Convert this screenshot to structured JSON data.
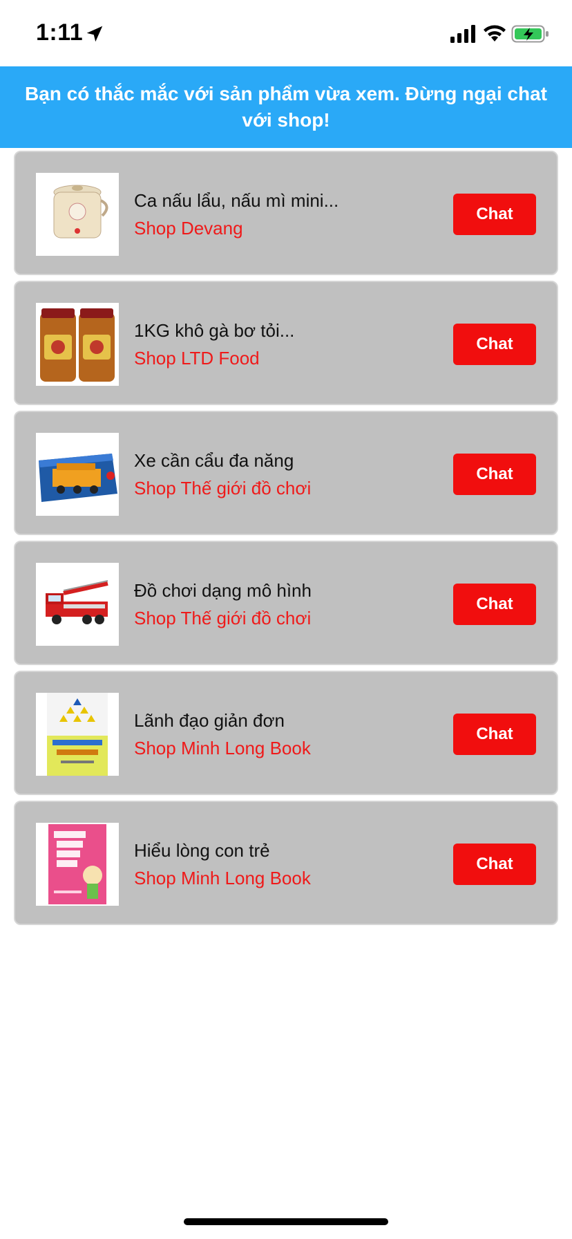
{
  "status_bar": {
    "time": "1:11",
    "icons": [
      "location-arrow-icon",
      "cellular-signal-icon",
      "wifi-icon",
      "battery-charging-icon"
    ]
  },
  "banner": {
    "text": "Bạn có thắc mắc với sản phẩm vừa xem. Đừng ngại chat với shop!",
    "background": "#2aa9f7"
  },
  "items": [
    {
      "name": "Ca nấu lẩu, nấu mì mini...",
      "shop": "Shop Devang",
      "chat_label": "Chat",
      "image": "electric-pot-image"
    },
    {
      "name": "1KG khô gà bơ tỏi...",
      "shop": "Shop LTD Food",
      "chat_label": "Chat",
      "image": "dried-chicken-jars-image"
    },
    {
      "name": "Xe cần cẩu đa năng",
      "shop": "Shop Thế giới đồ chơi",
      "chat_label": "Chat",
      "image": "crane-truck-toy-image"
    },
    {
      "name": "Đồ chơi dạng mô hình",
      "shop": "Shop Thế giới đồ chơi",
      "chat_label": "Chat",
      "image": "fire-truck-model-image"
    },
    {
      "name": "Lãnh đạo giản đơn",
      "shop": "Shop Minh Long Book",
      "chat_label": "Chat",
      "image": "book-cover-leadership-image"
    },
    {
      "name": "Hiểu lòng con trẻ",
      "shop": "Shop Minh Long Book",
      "chat_label": "Chat",
      "image": "book-cover-children-image"
    }
  ],
  "colors": {
    "accent_blue": "#2aa9f7",
    "chat_red": "#f10e0e",
    "shop_red": "#ef1a1a",
    "card_gray": "#c0c0c0"
  }
}
